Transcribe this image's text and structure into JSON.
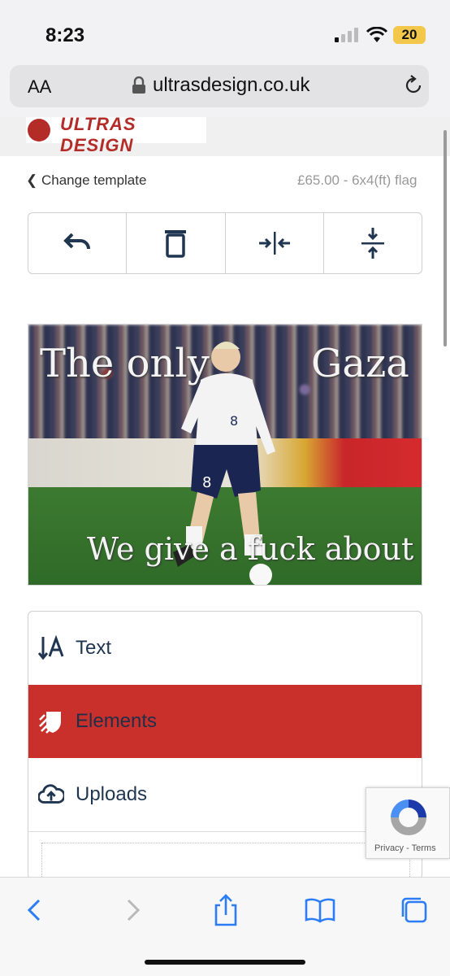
{
  "status": {
    "time": "8:23",
    "battery": "20"
  },
  "browser": {
    "aa": "AA",
    "url": "ultrasdesign.co.uk"
  },
  "site": {
    "logo_text": "ULTRAS DESIGN"
  },
  "nav": {
    "back_label": "Change template",
    "price": "£65.00 - 6x4(ft) flag"
  },
  "toolbar": {
    "tools": [
      "undo-icon",
      "delete-icon",
      "center-horizontal-icon",
      "center-vertical-icon"
    ]
  },
  "canvas": {
    "text_left": "The only",
    "text_right": "Gaza",
    "text_bottom": "We give a fuck about",
    "player_number": "8"
  },
  "menu": {
    "items": [
      {
        "label": "Text",
        "icon": "text-sort-icon"
      },
      {
        "label": "Elements",
        "icon": "shield-icon",
        "active": true
      },
      {
        "label": "Uploads",
        "icon": "cloud-upload-icon"
      }
    ]
  },
  "recaptcha": {
    "privacy": "Privacy",
    "sep": " - ",
    "terms": "Terms"
  },
  "colors": {
    "accent": "#c9302c",
    "nav_text": "#1f3550",
    "ios_blue": "#2b7cf6"
  }
}
